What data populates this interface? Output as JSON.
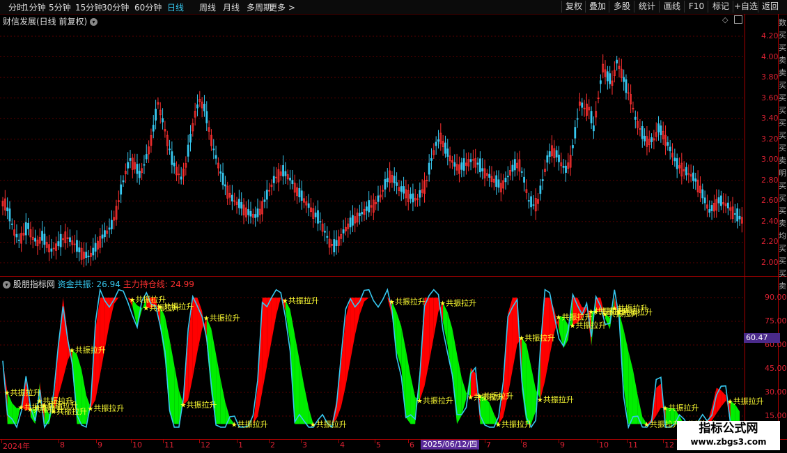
{
  "toolbar": {
    "periods": [
      "分时",
      "1分钟",
      "5分钟",
      "15分钟",
      "30分钟",
      "60分钟",
      "日线",
      "周线",
      "月线",
      "多周期",
      "更多"
    ],
    "active_period": "日线",
    "buttons": [
      "复权",
      "叠加",
      "多股",
      "统计",
      "画线",
      "F10",
      "标记",
      "+自选",
      "返回"
    ]
  },
  "main_chart": {
    "title": "财信发展(日线 前复权)",
    "price_ticks": [
      "4.20",
      "4.00",
      "3.80",
      "3.60",
      "3.40",
      "3.20",
      "3.00",
      "2.80",
      "2.60",
      "2.40",
      "2.20",
      "2.00"
    ]
  },
  "indicator": {
    "name": "股朋指标网",
    "series1_label": "资金共振: 26.94",
    "series2_label": "主力持仓线: 24.99",
    "ticks": [
      "90.00",
      "75.00",
      "60.00",
      "45.00",
      "30.00",
      "15.00"
    ],
    "cursor_value": "60.47",
    "signal_label": "共振拉升"
  },
  "time_axis": {
    "labels": [
      "2024年",
      "8",
      "9",
      "10",
      "11",
      "12",
      "1",
      "2",
      "3",
      "4",
      "5",
      "6",
      "7",
      "8",
      "9",
      "10",
      "11",
      "12",
      "1"
    ],
    "cursor_date": "2025/06/12/四"
  },
  "side_fragments": [
    "数",
    "买",
    "买",
    "卖",
    "卖",
    "买",
    "买",
    "买",
    "买",
    "买",
    "买",
    "卖",
    "明",
    "买",
    "买",
    "买",
    "卖",
    "均",
    "买",
    "买",
    "买",
    "卖"
  ],
  "watermark": {
    "line1": "指标公式网",
    "line2": "www.zbgs3.com"
  },
  "colors": {
    "up": "#ff3030",
    "down": "#36c8f0",
    "band_up": "#ff0000",
    "band_down": "#00ee00",
    "signal": "#ffff33"
  },
  "chart_data": {
    "type": "candlestick",
    "title": "财信发展(日线 前复权)",
    "ylim": [
      1.95,
      4.3
    ],
    "close": [
      2.58,
      2.45,
      2.3,
      2.22,
      2.28,
      2.35,
      2.24,
      2.2,
      2.25,
      2.18,
      2.12,
      2.16,
      2.2,
      2.26,
      2.22,
      2.18,
      2.12,
      2.08,
      2.06,
      2.1,
      2.18,
      2.25,
      2.3,
      2.36,
      2.5,
      2.7,
      2.88,
      3.0,
      2.95,
      2.85,
      2.95,
      3.1,
      3.3,
      3.55,
      3.38,
      3.2,
      3.0,
      2.9,
      2.82,
      2.95,
      3.2,
      3.45,
      3.58,
      3.5,
      3.3,
      3.1,
      2.95,
      2.8,
      2.7,
      2.62,
      2.58,
      2.55,
      2.5,
      2.47,
      2.45,
      2.5,
      2.6,
      2.7,
      2.8,
      2.86,
      2.88,
      2.84,
      2.78,
      2.7,
      2.64,
      2.58,
      2.52,
      2.46,
      2.4,
      2.3,
      2.2,
      2.15,
      2.22,
      2.3,
      2.36,
      2.4,
      2.45,
      2.48,
      2.52,
      2.55,
      2.58,
      2.65,
      2.75,
      2.85,
      2.8,
      2.72,
      2.7,
      2.66,
      2.62,
      2.62,
      2.7,
      2.8,
      3.0,
      3.15,
      3.22,
      3.1,
      3.02,
      2.95,
      2.92,
      2.94,
      2.98,
      3.0,
      2.96,
      2.9,
      2.86,
      2.82,
      2.78,
      2.74,
      2.8,
      2.88,
      2.94,
      2.96,
      2.8,
      2.6,
      2.56,
      2.6,
      2.8,
      3.0,
      3.1,
      3.05,
      2.96,
      2.9,
      3.0,
      3.25,
      3.55,
      3.5,
      3.5,
      3.3,
      3.6,
      3.9,
      3.8,
      3.75,
      3.95,
      3.85,
      3.7,
      3.6,
      3.4,
      3.3,
      3.2,
      3.18,
      3.2,
      3.3,
      3.25,
      3.15,
      3.05,
      2.95,
      2.92,
      2.88,
      2.85,
      2.8,
      2.72,
      2.6,
      2.5,
      2.55,
      2.6,
      2.58,
      2.55,
      2.5,
      2.45,
      2.42
    ],
    "xlabel": "",
    "ylabel": ""
  }
}
